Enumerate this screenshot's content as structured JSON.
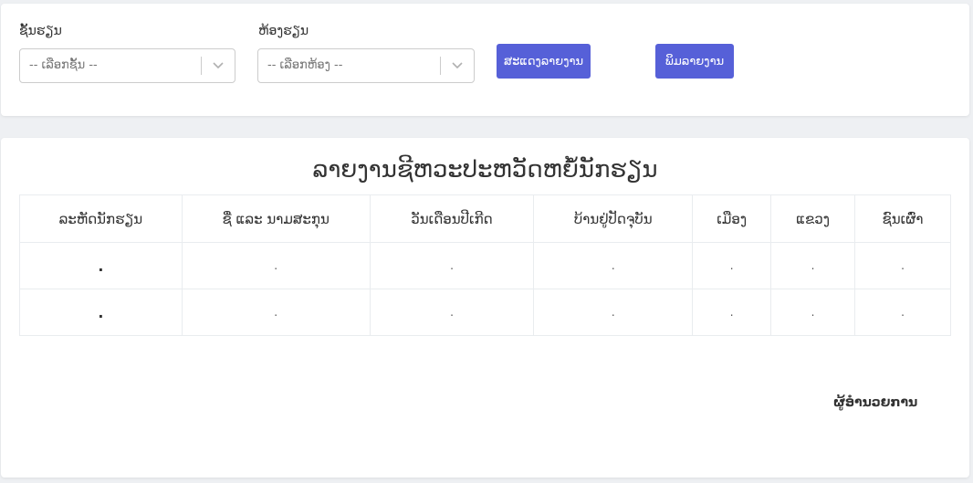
{
  "filters": {
    "class_label": "ຊັ້ນຮຽນ",
    "class_placeholder": "-- ເລືອກຊັ້ນ --",
    "room_label": "ຫ້ອງຮຽນ",
    "room_placeholder": "-- ເລືອກຫ້ອງ --",
    "show_button": "ສະແດງລາຍງານ",
    "print_button": "ພິມລາຍງານ"
  },
  "report": {
    "title": "ລາຍງານຊີຫວະປະຫວັດຫຍໍ້ນັກຮຽນ",
    "columns": [
      "ລະຫັດນັກຮຽນ",
      "ຊື່ ແລະ ນາມສະກຸນ",
      "ວັນເດືອນປີເກີດ",
      "ບ້ານຢູ່ປັດຈຸບັນ",
      "ເມືອງ",
      "ແຂວງ",
      "ຊົນເຜົ່າ"
    ],
    "rows": [
      [
        ".",
        ".",
        ".",
        ".",
        ".",
        ".",
        "."
      ],
      [
        ".",
        ".",
        ".",
        ".",
        ".",
        ".",
        "."
      ]
    ],
    "signature": "ຜູ້ອຳນວຍການ"
  },
  "colors": {
    "accent": "#5660d8",
    "page_bg": "#eef0f3"
  },
  "icons": {
    "select_arrow": "chevron-down-icon"
  }
}
